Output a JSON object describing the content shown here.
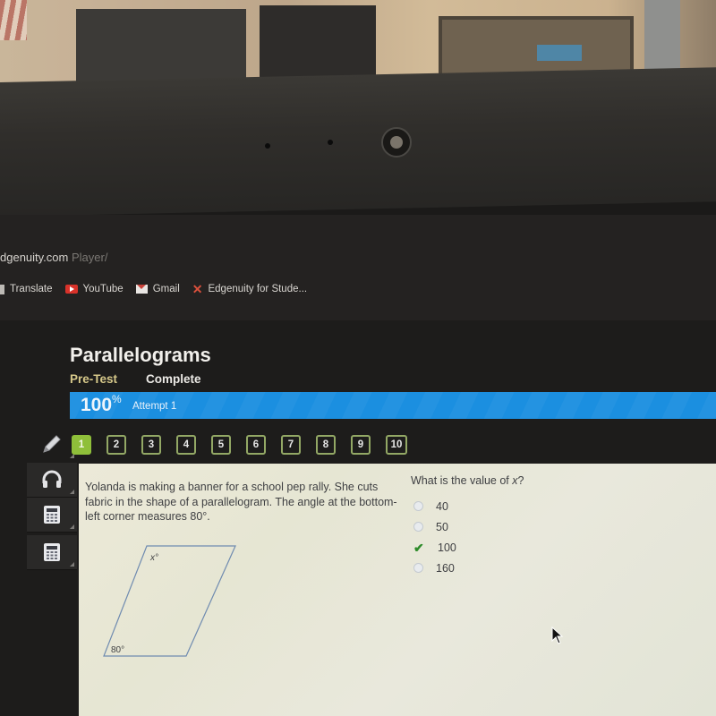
{
  "browser": {
    "url_domain": "dgenuity.com",
    "url_path": " Player/",
    "bookmarks": [
      {
        "label": "Translate",
        "icon": "translate-icon"
      },
      {
        "label": "YouTube",
        "icon": "youtube-icon"
      },
      {
        "label": "Gmail",
        "icon": "gmail-icon"
      },
      {
        "label": "Edgenuity for Stude...",
        "icon": "edgenuity-icon"
      }
    ]
  },
  "lesson": {
    "title": "Parallelograms",
    "tabs": [
      {
        "label": "Pre-Test",
        "active": true
      },
      {
        "label": "Complete",
        "active": false
      }
    ],
    "progress": {
      "percent_value": "100",
      "percent_sign": "%",
      "attempt_label": "Attempt 1",
      "fill_fraction": 1.0
    }
  },
  "tools": [
    {
      "name": "pencil",
      "icon": "pencil-icon"
    },
    {
      "name": "audio",
      "icon": "headphones-icon"
    },
    {
      "name": "calculator",
      "icon": "calculator-icon"
    },
    {
      "name": "calculator-2",
      "icon": "calculator-icon"
    }
  ],
  "question_nav": {
    "current": 1,
    "items": [
      "1",
      "2",
      "3",
      "4",
      "5",
      "6",
      "7",
      "8",
      "9",
      "10"
    ]
  },
  "problem": {
    "prompt": "Yolanda is making a banner for a school pep rally. She cuts fabric in the shape of a parallelogram. The angle at the bottom-left corner measures 80°.",
    "diagram": {
      "top_left_label": "x°",
      "bottom_left_label": "80°"
    },
    "question_prefix": "What is the value of ",
    "question_var": "x",
    "question_suffix": "?",
    "options": [
      {
        "label": "40",
        "state": "unselected"
      },
      {
        "label": "50",
        "state": "unselected"
      },
      {
        "label": "100",
        "state": "correct"
      },
      {
        "label": "160",
        "state": "unselected"
      }
    ]
  },
  "colors": {
    "progress_blue": "#1b8fe0",
    "active_question_green": "#8fbf3a",
    "pretest_gold": "#d6c88a",
    "check_green": "#2e8b2a"
  }
}
